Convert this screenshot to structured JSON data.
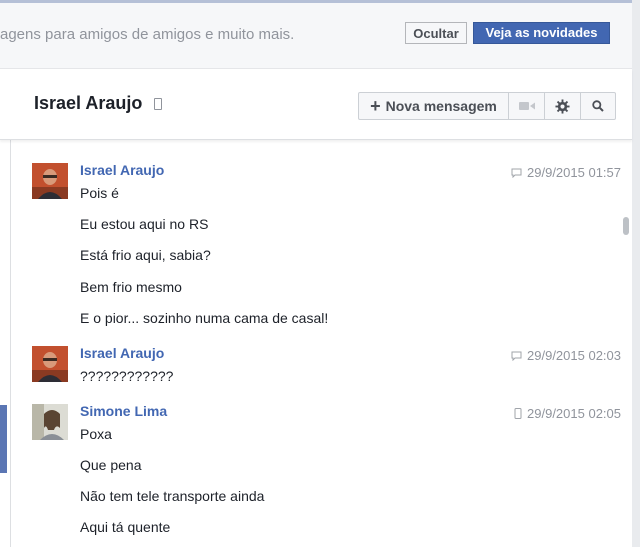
{
  "banner": {
    "text": "agens para amigos de amigos e muito mais.",
    "hide_label": "Ocultar",
    "news_label": "Veja as novidades"
  },
  "conversation": {
    "title": "Israel Araujo",
    "new_message_label": "Nova mensagem",
    "icons": [
      "mobile-icon",
      "video-icon",
      "gear-icon",
      "search-icon"
    ]
  },
  "messages": [
    {
      "sender": "Israel Araujo",
      "timestamp": "29/9/2015 01:57",
      "source_icon": "chat-icon",
      "lines": [
        "Pois é",
        "Eu estou aqui no RS",
        "Está frio aqui, sabia?",
        "Bem frio mesmo",
        "E o pior... sozinho numa cama de casal!"
      ]
    },
    {
      "sender": "Israel Araujo",
      "timestamp": "29/9/2015 02:03",
      "source_icon": "chat-icon",
      "lines": [
        "????????????"
      ]
    },
    {
      "sender": "Simone Lima",
      "timestamp": "29/9/2015 02:05",
      "source_icon": "mobile-icon",
      "lines": [
        "Poxa",
        "Que pena",
        "Não tem tele transporte ainda",
        "Aqui tá quente"
      ]
    }
  ],
  "colors": {
    "brand": "#4267b2",
    "sender": "#4267b2",
    "muted": "#90949c",
    "text": "#1d2129"
  }
}
